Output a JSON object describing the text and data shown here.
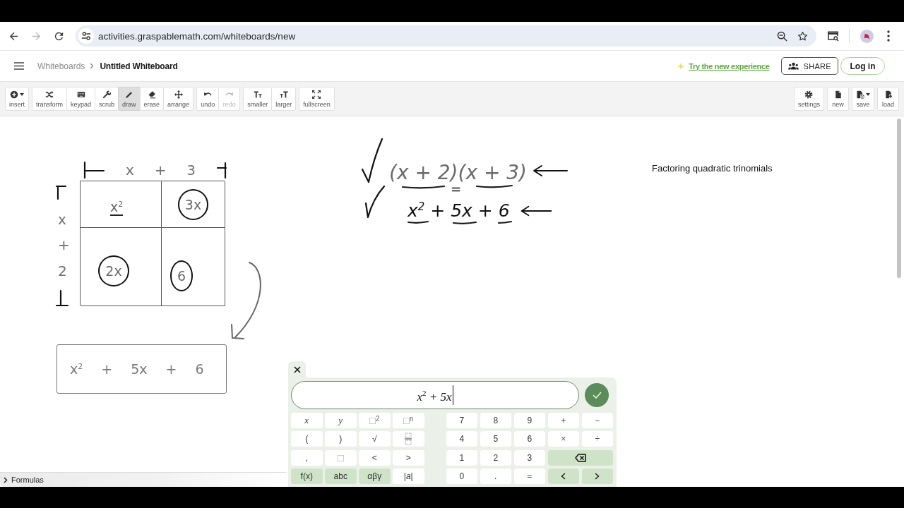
{
  "browser": {
    "nav_buttons": [
      {
        "kind": "back",
        "disabled": false
      },
      {
        "kind": "forward",
        "disabled": true
      },
      {
        "kind": "reload",
        "disabled": false
      }
    ],
    "url": "activities.graspablemath.com/whiteboards/new"
  },
  "header": {
    "breadcrumb": [
      {
        "label": "Whiteboards",
        "current": false
      },
      {
        "label": "Untitled Whiteboard",
        "current": true
      }
    ],
    "promo_link": "Try the new experience",
    "share_button": "SHARE",
    "login_button": "Log in"
  },
  "toolbar": {
    "left_groups": [
      {
        "buttons": [
          {
            "kind": "insert",
            "label": "insert",
            "caret": true,
            "selected": false,
            "disabled": false
          }
        ]
      },
      {
        "buttons": [
          {
            "kind": "transform",
            "label": "transform",
            "caret": false,
            "selected": false,
            "disabled": false
          },
          {
            "kind": "keypad",
            "label": "keypad",
            "caret": false,
            "selected": false,
            "disabled": false
          },
          {
            "kind": "scrub",
            "label": "scrub",
            "caret": false,
            "selected": false,
            "disabled": false
          },
          {
            "kind": "draw",
            "label": "draw",
            "caret": false,
            "selected": true,
            "disabled": false
          },
          {
            "kind": "erase",
            "label": "erase",
            "caret": false,
            "selected": false,
            "disabled": false
          },
          {
            "kind": "arrange",
            "label": "arrange",
            "caret": false,
            "selected": false,
            "disabled": false
          }
        ]
      },
      {
        "buttons": [
          {
            "kind": "undo",
            "label": "undo",
            "caret": false,
            "selected": false,
            "disabled": false
          },
          {
            "kind": "redo",
            "label": "redo",
            "caret": false,
            "selected": false,
            "disabled": true
          }
        ]
      },
      {
        "buttons": [
          {
            "kind": "smaller",
            "label": "smaller",
            "caret": false,
            "selected": false,
            "disabled": false
          },
          {
            "kind": "larger",
            "label": "larger",
            "caret": false,
            "selected": false,
            "disabled": false
          }
        ]
      },
      {
        "buttons": [
          {
            "kind": "fullscreen",
            "label": "fullscreen",
            "caret": false,
            "selected": false,
            "disabled": false
          }
        ]
      }
    ],
    "right_groups": [
      {
        "buttons": [
          {
            "kind": "settings",
            "label": "settings",
            "caret": false,
            "selected": false,
            "disabled": false
          }
        ]
      },
      {
        "buttons": [
          {
            "kind": "new",
            "label": "new",
            "caret": false,
            "selected": false,
            "disabled": false
          }
        ]
      },
      {
        "buttons": [
          {
            "kind": "save",
            "label": "save",
            "caret": true,
            "selected": false,
            "disabled": false
          }
        ]
      },
      {
        "buttons": [
          {
            "kind": "load",
            "label": "load",
            "caret": false,
            "selected": false,
            "disabled": false
          }
        ]
      }
    ]
  },
  "whiteboard": {
    "area_model": {
      "top_labels": [
        "x",
        "+",
        "3"
      ],
      "side_labels": [
        "x",
        "+",
        "2"
      ],
      "cells": [
        {
          "term": "x$^{2}$",
          "circled": false,
          "underlined": true
        },
        {
          "term": "3x",
          "circled": true,
          "underlined": false
        },
        {
          "term": "2x",
          "circled": true,
          "underlined": false
        },
        {
          "term": "6",
          "circled": true,
          "underlined": false
        }
      ],
      "result": "x$^{2}$ + 5x + 6"
    },
    "derivation": {
      "steps": [
        {
          "expression": "(x + 2)(x + 3)",
          "active": false,
          "checked": true,
          "arrow": true
        },
        {
          "expression": "x$^{2}$ + 5x + 6",
          "active": true,
          "checked": true,
          "arrow": true
        }
      ],
      "connector": "="
    },
    "note": "Factoring quadratic trinomials"
  },
  "keypad": {
    "input": {
      "value": "x$^{2}$ + 5x"
    },
    "rows": [
      {
        "keys": [
          {
            "label": "x",
            "kind": "variable"
          },
          {
            "label": "y",
            "kind": "variable"
          },
          {
            "label": "□$^{2}$",
            "kind": "template"
          },
          {
            "label": "□$^{n}$",
            "kind": "template"
          },
          {
            "label": "7",
            "kind": "digit"
          },
          {
            "label": "8",
            "kind": "digit"
          },
          {
            "label": "9",
            "kind": "digit"
          },
          {
            "label": "+",
            "kind": "operator"
          },
          {
            "label": "−",
            "kind": "operator"
          }
        ]
      },
      {
        "keys": [
          {
            "label": "(",
            "kind": "symbol"
          },
          {
            "label": ")",
            "kind": "symbol"
          },
          {
            "label": "√",
            "kind": "symbol"
          },
          {
            "kind": "fraction"
          },
          {
            "label": "4",
            "kind": "digit"
          },
          {
            "label": "5",
            "kind": "digit"
          },
          {
            "label": "6",
            "kind": "digit"
          },
          {
            "label": "×",
            "kind": "operator"
          },
          {
            "label": "÷",
            "kind": "operator"
          }
        ]
      },
      {
        "keys": [
          {
            "label": ",",
            "kind": "symbol"
          },
          {
            "label": "□",
            "kind": "template"
          },
          {
            "label": "<",
            "kind": "symbol"
          },
          {
            "label": ">",
            "kind": "symbol"
          },
          {
            "label": "1",
            "kind": "digit"
          },
          {
            "label": "2",
            "kind": "digit"
          },
          {
            "label": "3",
            "kind": "digit"
          },
          {
            "kind": "backspace"
          }
        ]
      },
      {
        "keys": [
          {
            "label": "f(x)",
            "kind": "mode"
          },
          {
            "label": "abc",
            "kind": "mode"
          },
          {
            "label": "αβγ",
            "kind": "mode"
          },
          {
            "label": "|*a*|",
            "kind": "symbol"
          },
          {
            "label": "0",
            "kind": "digit"
          },
          {
            "label": ".",
            "kind": "digit"
          },
          {
            "label": "=",
            "kind": "operator"
          },
          {
            "kind": "cursor_left"
          },
          {
            "kind": "cursor_right"
          }
        ]
      }
    ]
  },
  "formulas_panel": {
    "label": "Formulas",
    "expanded": false
  }
}
